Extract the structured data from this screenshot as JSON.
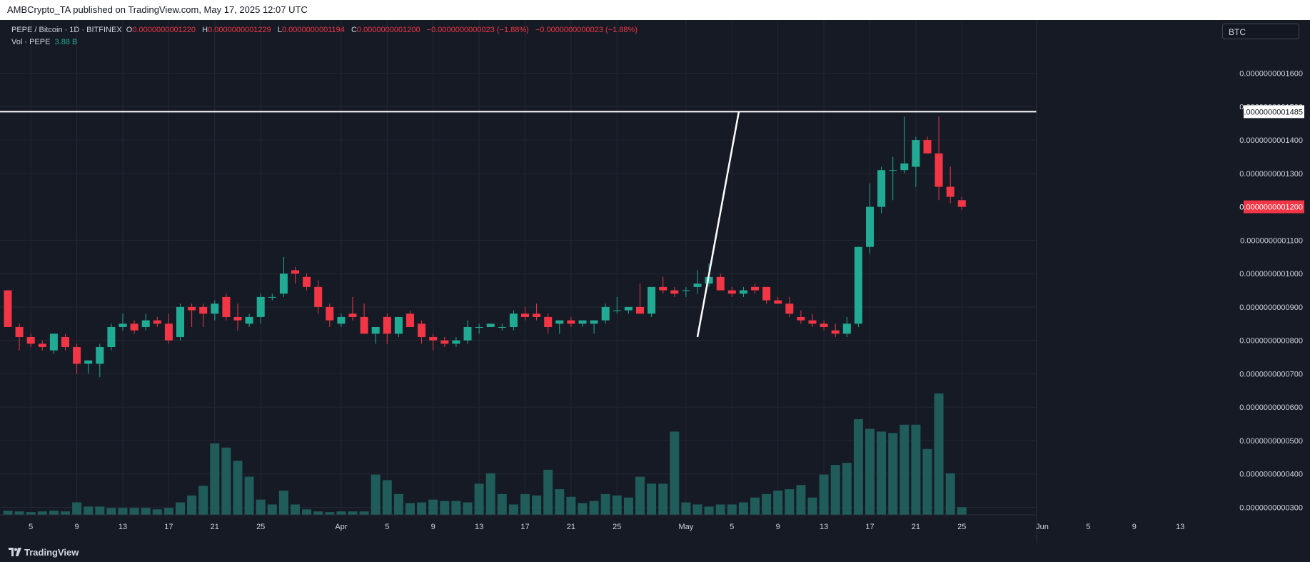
{
  "header": {
    "published_by": "AMBCrypto_TA published on TradingView.com, May 17, 2025 12:07 UTC"
  },
  "legend": {
    "symbol": "PEPE / Bitcoin · 1D · BITFINEX",
    "o_label": "O",
    "o_value": "0.0000000001220",
    "h_label": "H",
    "h_value": "0.0000000001229",
    "l_label": "L",
    "l_value": "0.0000000001194",
    "c_label": "C",
    "c_value": "0.0000000001200",
    "change": "−0.0000000000023 (−1.88%)",
    "change2": "−0.0000000000023 (−1.88%)",
    "vol_label": "Vol · PEPE",
    "vol_value": "3.88 B"
  },
  "currency": "BTC",
  "footer": {
    "brand": "TradingView"
  },
  "colors": {
    "up": "#22ab94",
    "down": "#f23645",
    "volume": "#1f5c5a",
    "background": "#161a25"
  },
  "chart_data": {
    "type": "candlestick",
    "price_axis": {
      "ticks": [
        {
          "v": 1.6,
          "label": "0.0000000001600"
        },
        {
          "v": 1.5,
          "label": "0.0000000001500"
        },
        {
          "v": 1.4,
          "label": "0.0000000001400"
        },
        {
          "v": 1.3,
          "label": "0.0000000001300"
        },
        {
          "v": 1.1,
          "label": "0.0000000001100"
        },
        {
          "v": 1.0,
          "label": "0.0000000001000"
        },
        {
          "v": 0.9,
          "label": "0.0000000000900"
        },
        {
          "v": 0.8,
          "label": "0.0000000000800"
        },
        {
          "v": 0.7,
          "label": "0.0000000000700"
        },
        {
          "v": 0.6,
          "label": "0.0000000000600"
        },
        {
          "v": 0.5,
          "label": "0.0000000000500"
        },
        {
          "v": 0.4,
          "label": "0.0000000000400"
        },
        {
          "v": 0.3,
          "label": "0.0000000000300"
        }
      ],
      "range": [
        0.2775,
        1.7595
      ]
    },
    "horizontal_line": {
      "v": 1.485,
      "label": "0.0000000001485"
    },
    "last_price": {
      "v": 1.2,
      "label": "0.0000000001200"
    },
    "trend_line": [
      [
        60,
        0.81
      ],
      [
        63.6,
        1.485
      ]
    ],
    "x_axis": {
      "ticks": [
        {
          "i": 2,
          "label": "5"
        },
        {
          "i": 6,
          "label": "9"
        },
        {
          "i": 10,
          "label": "13"
        },
        {
          "i": 14,
          "label": "17"
        },
        {
          "i": 18,
          "label": "21"
        },
        {
          "i": 22,
          "label": "25"
        },
        {
          "i": 29,
          "label": "Apr"
        },
        {
          "i": 33,
          "label": "5"
        },
        {
          "i": 37,
          "label": "9"
        },
        {
          "i": 41,
          "label": "13"
        },
        {
          "i": 45,
          "label": "17"
        },
        {
          "i": 49,
          "label": "21"
        },
        {
          "i": 53,
          "label": "25"
        },
        {
          "i": 59,
          "label": "May"
        },
        {
          "i": 63,
          "label": "5"
        },
        {
          "i": 67,
          "label": "9"
        },
        {
          "i": 71,
          "label": "13"
        },
        {
          "i": 75,
          "label": "17"
        },
        {
          "i": 79,
          "label": "21"
        },
        {
          "i": 83,
          "label": "25"
        },
        {
          "i": 90,
          "label": "Jun"
        },
        {
          "i": 94,
          "label": "5"
        },
        {
          "i": 98,
          "label": "9"
        },
        {
          "i": 102,
          "label": "13"
        }
      ]
    },
    "candles": [
      [
        0.95,
        0.95,
        0.84,
        0.84,
        0.06
      ],
      [
        0.84,
        0.85,
        0.77,
        0.81,
        0.05
      ],
      [
        0.81,
        0.82,
        0.78,
        0.79,
        0.04
      ],
      [
        0.79,
        0.8,
        0.77,
        0.78,
        0.05
      ],
      [
        0.77,
        0.82,
        0.76,
        0.82,
        0.06
      ],
      [
        0.81,
        0.82,
        0.77,
        0.78,
        0.05
      ],
      [
        0.78,
        0.79,
        0.7,
        0.73,
        0.18
      ],
      [
        0.73,
        0.74,
        0.7,
        0.74,
        0.12
      ],
      [
        0.73,
        0.79,
        0.69,
        0.78,
        0.12
      ],
      [
        0.78,
        0.85,
        0.77,
        0.84,
        0.1
      ],
      [
        0.84,
        0.88,
        0.83,
        0.85,
        0.1
      ],
      [
        0.85,
        0.86,
        0.82,
        0.83,
        0.1
      ],
      [
        0.84,
        0.88,
        0.83,
        0.86,
        0.1
      ],
      [
        0.86,
        0.87,
        0.84,
        0.85,
        0.08
      ],
      [
        0.85,
        0.88,
        0.79,
        0.8,
        0.1
      ],
      [
        0.81,
        0.91,
        0.8,
        0.9,
        0.18
      ],
      [
        0.9,
        0.91,
        0.84,
        0.89,
        0.28
      ],
      [
        0.9,
        0.91,
        0.84,
        0.88,
        0.42
      ],
      [
        0.88,
        0.92,
        0.86,
        0.91,
        1.03
      ],
      [
        0.93,
        0.94,
        0.86,
        0.87,
        0.97
      ],
      [
        0.87,
        0.91,
        0.83,
        0.86,
        0.78
      ],
      [
        0.85,
        0.88,
        0.84,
        0.87,
        0.55
      ],
      [
        0.87,
        0.94,
        0.85,
        0.93,
        0.22
      ],
      [
        0.93,
        0.94,
        0.92,
        0.93,
        0.15
      ],
      [
        0.94,
        1.05,
        0.93,
        1.0,
        0.35
      ],
      [
        1.01,
        1.02,
        0.97,
        1.0,
        0.15
      ],
      [
        0.99,
        1.0,
        0.95,
        0.96,
        0.08
      ],
      [
        0.96,
        0.98,
        0.88,
        0.9,
        0.05
      ],
      [
        0.9,
        0.91,
        0.84,
        0.86,
        0.04
      ],
      [
        0.85,
        0.88,
        0.84,
        0.87,
        0.05
      ],
      [
        0.88,
        0.93,
        0.86,
        0.87,
        0.05
      ],
      [
        0.87,
        0.91,
        0.84,
        0.82,
        0.05
      ],
      [
        0.82,
        0.83,
        0.79,
        0.84,
        0.58
      ],
      [
        0.87,
        0.88,
        0.79,
        0.82,
        0.5
      ],
      [
        0.82,
        0.87,
        0.81,
        0.87,
        0.3
      ],
      [
        0.88,
        0.89,
        0.84,
        0.84,
        0.17
      ],
      [
        0.85,
        0.86,
        0.79,
        0.81,
        0.18
      ],
      [
        0.81,
        0.82,
        0.77,
        0.8,
        0.22
      ],
      [
        0.8,
        0.81,
        0.78,
        0.79,
        0.2
      ],
      [
        0.79,
        0.81,
        0.78,
        0.8,
        0.2
      ],
      [
        0.8,
        0.86,
        0.79,
        0.84,
        0.18
      ],
      [
        0.84,
        0.85,
        0.82,
        0.84,
        0.45
      ],
      [
        0.84,
        0.85,
        0.84,
        0.85,
        0.6
      ],
      [
        0.84,
        0.85,
        0.83,
        0.84,
        0.3
      ],
      [
        0.84,
        0.89,
        0.83,
        0.88,
        0.15
      ],
      [
        0.88,
        0.9,
        0.86,
        0.87,
        0.3
      ],
      [
        0.88,
        0.91,
        0.86,
        0.87,
        0.28
      ],
      [
        0.87,
        0.88,
        0.82,
        0.84,
        0.65
      ],
      [
        0.85,
        0.86,
        0.82,
        0.86,
        0.37
      ],
      [
        0.86,
        0.87,
        0.84,
        0.85,
        0.26
      ],
      [
        0.85,
        0.86,
        0.84,
        0.86,
        0.17
      ],
      [
        0.85,
        0.86,
        0.82,
        0.86,
        0.2
      ],
      [
        0.86,
        0.91,
        0.85,
        0.9,
        0.3
      ],
      [
        0.89,
        0.93,
        0.88,
        0.89,
        0.28
      ],
      [
        0.89,
        0.9,
        0.88,
        0.9,
        0.25
      ],
      [
        0.9,
        0.97,
        0.88,
        0.88,
        0.55
      ],
      [
        0.88,
        0.92,
        0.87,
        0.96,
        0.45
      ],
      [
        0.96,
        0.99,
        0.94,
        0.95,
        0.45
      ],
      [
        0.95,
        0.96,
        0.93,
        0.94,
        1.2
      ],
      [
        0.95,
        0.96,
        0.93,
        0.95,
        0.18
      ],
      [
        0.96,
        1.01,
        0.94,
        0.97,
        0.15
      ],
      [
        0.97,
        1.03,
        0.96,
        0.99,
        0.12
      ],
      [
        0.99,
        1.0,
        0.96,
        0.95,
        0.15
      ],
      [
        0.95,
        0.96,
        0.93,
        0.94,
        0.15
      ],
      [
        0.94,
        0.96,
        0.93,
        0.95,
        0.18
      ],
      [
        0.96,
        0.97,
        0.94,
        0.95,
        0.25
      ],
      [
        0.96,
        0.96,
        0.91,
        0.92,
        0.3
      ],
      [
        0.92,
        0.93,
        0.91,
        0.91,
        0.35
      ],
      [
        0.91,
        0.93,
        0.87,
        0.88,
        0.37
      ],
      [
        0.87,
        0.89,
        0.85,
        0.86,
        0.43
      ],
      [
        0.86,
        0.88,
        0.84,
        0.85,
        0.25
      ],
      [
        0.85,
        0.86,
        0.83,
        0.84,
        0.58
      ],
      [
        0.83,
        0.85,
        0.81,
        0.82,
        0.72
      ],
      [
        0.82,
        0.87,
        0.81,
        0.85,
        0.75
      ],
      [
        0.85,
        1.08,
        0.84,
        1.08,
        1.38
      ],
      [
        1.08,
        1.27,
        1.06,
        1.2,
        1.24
      ],
      [
        1.2,
        1.32,
        1.18,
        1.31,
        1.2
      ],
      [
        1.31,
        1.35,
        1.22,
        1.31,
        1.18
      ],
      [
        1.31,
        1.47,
        1.3,
        1.33,
        1.3
      ],
      [
        1.32,
        1.41,
        1.26,
        1.4,
        1.3
      ],
      [
        1.4,
        1.41,
        1.36,
        1.36,
        0.95
      ],
      [
        1.36,
        1.47,
        1.22,
        1.26,
        1.75
      ],
      [
        1.26,
        1.32,
        1.21,
        1.23,
        0.6
      ],
      [
        1.22,
        1.23,
        1.19,
        1.2,
        0.11
      ]
    ]
  }
}
